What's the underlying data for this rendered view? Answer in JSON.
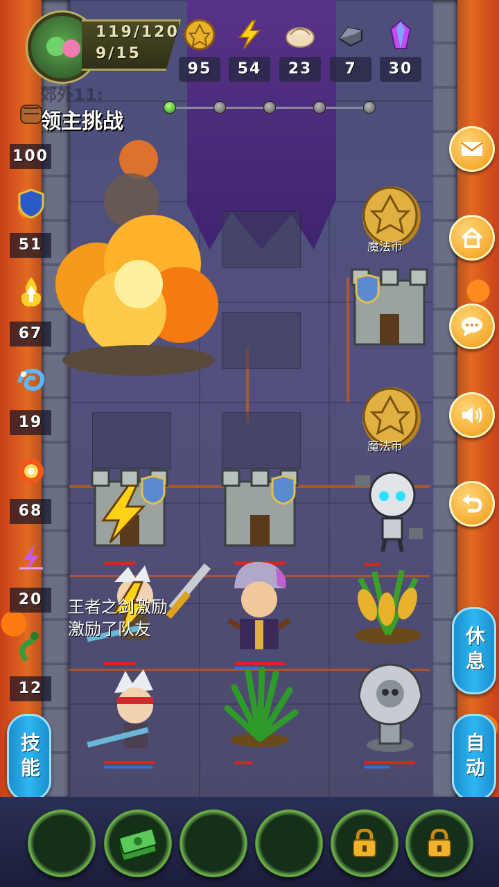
{
  "player": {
    "hp_text": "119/120",
    "level_text": "9/15"
  },
  "resources": [
    {
      "name": "gold-coin",
      "value": "95"
    },
    {
      "name": "energy",
      "value": "54"
    },
    {
      "name": "dumpling",
      "value": "23"
    },
    {
      "name": "iron-ore",
      "value": "7"
    },
    {
      "name": "crystal",
      "value": "30"
    }
  ],
  "stage": {
    "ghost_text": "郊外11:",
    "boss_label": "领主挑战",
    "progress_total": 5,
    "progress_current": 1
  },
  "left_stats": [
    {
      "icon": "fist-icon",
      "value": "100"
    },
    {
      "icon": "shield-icon",
      "value": "51"
    },
    {
      "icon": "flame-arrow-icon",
      "value": "67"
    },
    {
      "icon": "water-swirl-icon",
      "value": "19"
    },
    {
      "icon": "fireball-icon",
      "value": "68"
    },
    {
      "icon": "lightning-crystal-icon",
      "value": "20"
    },
    {
      "icon": "snake-icon",
      "value": "12"
    }
  ],
  "right_buttons": [
    "mail-icon",
    "home-icon",
    "chat-icon",
    "sound-icon",
    "back-icon"
  ],
  "side_buttons": {
    "skill": "技能",
    "rest": "休息",
    "auto": "自动"
  },
  "board": {
    "coin_label_1": "魔法币",
    "coin_label_2": "魔法币",
    "battle_text_line1": "王者之剑激励",
    "battle_text_line2": "激励了队友"
  },
  "skill_slots": [
    {
      "state": "empty"
    },
    {
      "state": "item",
      "icon": "cash-stack-icon"
    },
    {
      "state": "empty"
    },
    {
      "state": "empty"
    },
    {
      "state": "locked"
    },
    {
      "state": "locked"
    }
  ]
}
